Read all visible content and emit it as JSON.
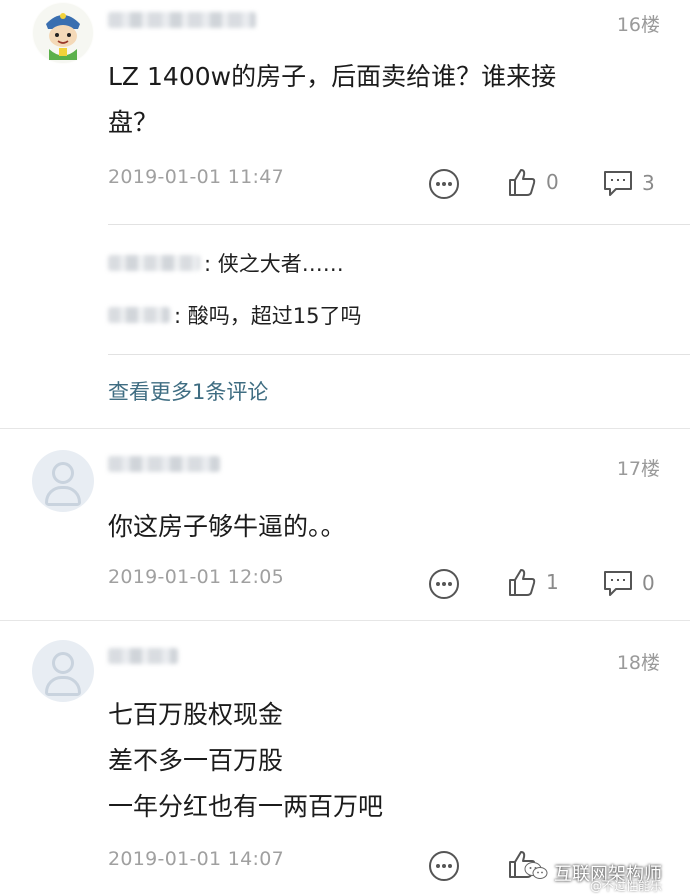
{
  "posts": [
    {
      "floor": "16楼",
      "content": "LZ 1400w的房子，后面卖给谁？谁来接\n盘？",
      "date": "2019-01-01 11:47",
      "likes": "0",
      "comments": "3",
      "replies": [
        {
          "text": ": 侠之大者……"
        },
        {
          "text": ": 酸吗，超过15了吗"
        }
      ],
      "view_more": "查看更多1条评论"
    },
    {
      "floor": "17楼",
      "content": "你这房子够牛逼的。。",
      "date": "2019-01-01 12:05",
      "likes": "1",
      "comments": "0"
    },
    {
      "floor": "18楼",
      "content": "七百万股权现金\n差不多一百万股\n一年分红也有一两百万吧",
      "date": "2019-01-01 14:07"
    }
  ],
  "watermark": {
    "text": "互联网架构师",
    "sub": "@不过性能乐"
  },
  "icons": {
    "more": "more-dots-icon",
    "like": "thumbs-up-icon",
    "comment": "comment-bubble-icon",
    "wechat": "wechat-icon"
  },
  "colors": {
    "link": "#3f6d82",
    "meta": "#a0a0a0"
  }
}
